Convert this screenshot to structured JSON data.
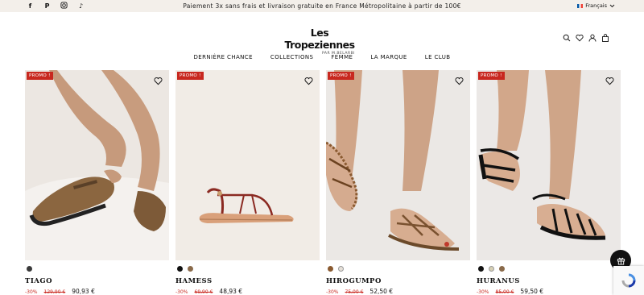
{
  "topbar": {
    "social_icons": [
      "facebook-icon",
      "pinterest-icon",
      "instagram-icon",
      "tiktok-icon"
    ],
    "banner_text": "Paiement 3x sans frais et livraison gratuite en France Métropolitaine à partir de 100€",
    "language": "Français"
  },
  "header": {
    "logo_text": "Les Tropeziennes",
    "logo_sub": "PAR M.BELARBI",
    "icons": [
      "search-icon",
      "heart-icon",
      "account-icon",
      "bag-icon"
    ]
  },
  "nav": {
    "items": [
      "DERNIÈRE CHANCE",
      "COLLECTIONS",
      "FEMME",
      "LA MARQUE",
      "LE CLUB"
    ]
  },
  "products": [
    {
      "badge": "PROMO !",
      "name": "TIAGO",
      "discount": "-30%",
      "old_price": "129,90 €",
      "price": "90,93 €",
      "swatches": [
        "#3a3a3a"
      ]
    },
    {
      "badge": "PROMO !",
      "name": "HAMESS",
      "discount": "-30%",
      "old_price": "69,90 €",
      "price": "48,93 €",
      "swatches": [
        "#111111",
        "#8a6a4a"
      ]
    },
    {
      "badge": "PROMO !",
      "name": "HIROGUMPO",
      "discount": "-30%",
      "old_price": "75,00 €",
      "price": "52,50 €",
      "swatches": [
        "#8a5a30",
        "#e6e0d8"
      ]
    },
    {
      "badge": "PROMO !",
      "name": "HURANUS",
      "discount": "-30%",
      "old_price": "85,00 €",
      "price": "59,50 €",
      "swatches": [
        "#111111",
        "#d7d0b4",
        "#8a6a4a"
      ]
    }
  ],
  "colors": {
    "promo_red": "#c8281f",
    "topbar_bg": "#f3efea"
  }
}
